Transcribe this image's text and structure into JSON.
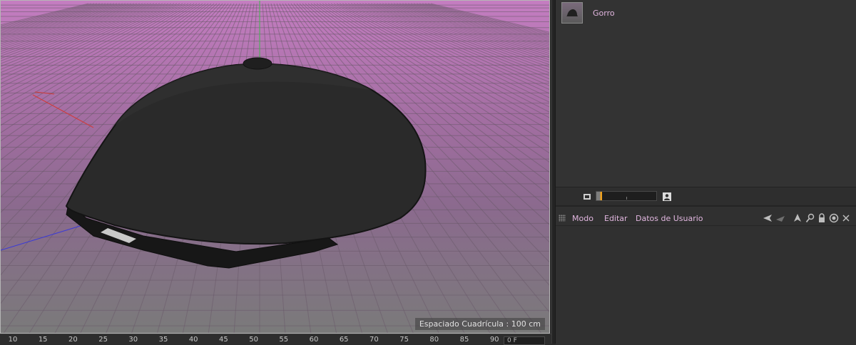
{
  "viewport": {
    "grid_spacing_label": "Espaciado Cuadrícula : 100 cm",
    "background_top": "#c47dc1",
    "background_bottom": "#7a7a7a"
  },
  "timeline": {
    "ticks": [
      "10",
      "15",
      "20",
      "25",
      "30",
      "35",
      "40",
      "45",
      "50",
      "55",
      "60",
      "65",
      "70",
      "75",
      "80",
      "85",
      "90"
    ],
    "frame_field": "0 F"
  },
  "object_manager": {
    "objects": [
      {
        "name": "Gorro",
        "icon": "cap-thumbnail-icon"
      }
    ],
    "name_color": "#e2b7e0"
  },
  "layer_bar": {
    "left_icon": "layer-left-icon",
    "right_icon": "layer-right-icon"
  },
  "attribute_manager": {
    "menu": {
      "modo": "Modo",
      "editar": "Editar",
      "datos_usuario": "Datos de Usuario"
    },
    "tools": [
      "back-arrow-icon",
      "pointer-icon",
      "up-arrow-icon",
      "search-icon",
      "lock-icon",
      "target-icon",
      "more-icon"
    ]
  }
}
